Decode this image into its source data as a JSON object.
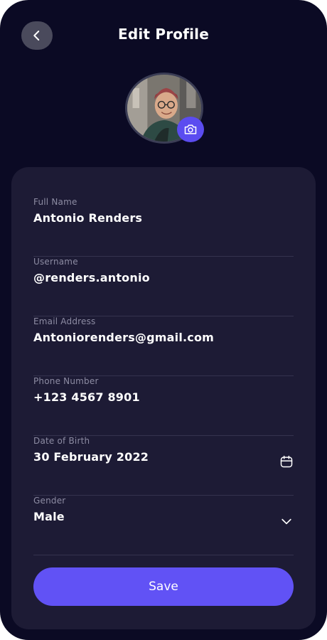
{
  "header": {
    "title": "Edit Profile",
    "back_icon": "chevron-left-icon"
  },
  "avatar": {
    "camera_icon": "camera-icon"
  },
  "form": {
    "full_name": {
      "label": "Full Name",
      "value": "Antonio Renders"
    },
    "username": {
      "label": "Username",
      "value": "@renders.antonio"
    },
    "email": {
      "label": "Email Address",
      "value": "Antoniorenders@gmail.com"
    },
    "phone": {
      "label": "Phone Number",
      "value": "+123 4567 8901"
    },
    "dob": {
      "label": "Date of Birth",
      "value": "30 February 2022",
      "icon": "calendar-icon"
    },
    "gender": {
      "label": "Gender",
      "value": "Male",
      "icon": "chevron-down-icon"
    }
  },
  "save_button": {
    "label": "Save"
  },
  "colors": {
    "background": "#0b0a24",
    "card": "#1d1b35",
    "accent": "#6152f5",
    "label": "#8d8ca3",
    "divider": "#35334e"
  }
}
